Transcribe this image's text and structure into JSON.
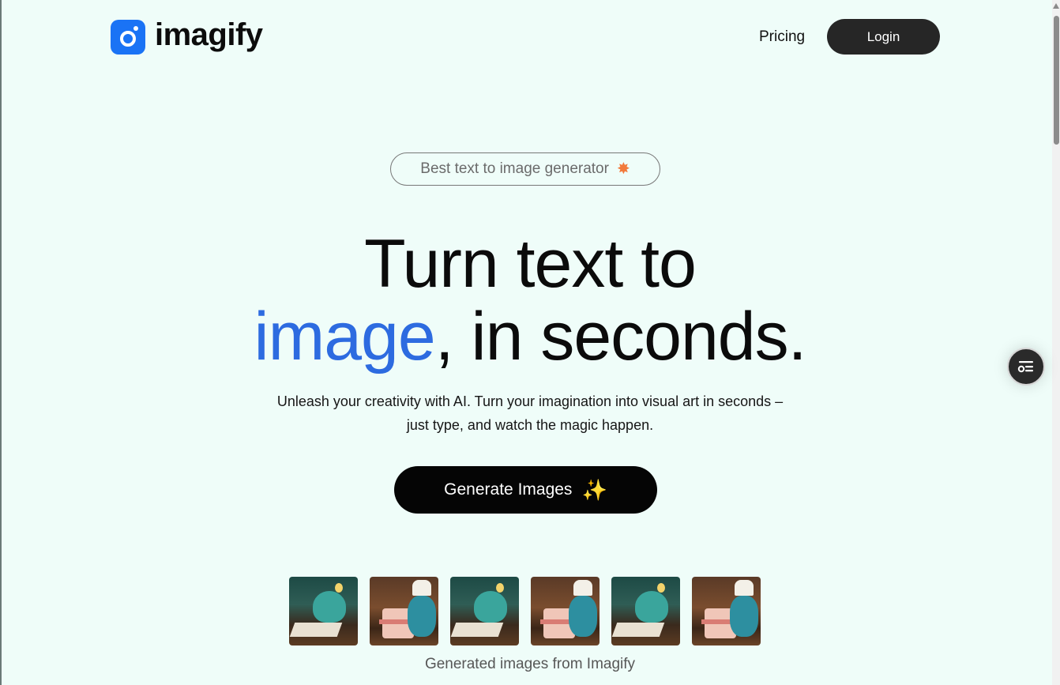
{
  "brand": {
    "name": "imagify",
    "color": "#1a73f5"
  },
  "nav": {
    "pricing_label": "Pricing",
    "login_label": "Login"
  },
  "hero": {
    "badge_text": "Best text to image generator",
    "badge_icon": "star-icon",
    "headline_line1": "Turn text to",
    "headline_accent": "image",
    "headline_rest": ", in seconds.",
    "accent_color": "#2d6be0",
    "subtitle_line1": "Unleash your creativity with AI. Turn your imagination into visual art in seconds –",
    "subtitle_line2": "just type, and watch the magic happen.",
    "cta_label": "Generate Images",
    "cta_icon": "sparkle-icon"
  },
  "gallery": {
    "images": [
      "monster-writing",
      "monster-cake",
      "monster-writing",
      "monster-cake",
      "monster-writing",
      "monster-cake"
    ],
    "caption": "Generated images from Imagify"
  },
  "widget": {
    "icon": "list-settings-icon"
  }
}
